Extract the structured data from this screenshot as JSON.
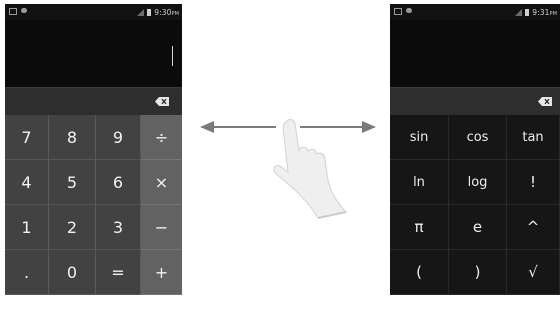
{
  "left_phone": {
    "status_time": "9:30",
    "status_ampm": "PM",
    "keys": [
      {
        "label": "7",
        "name": "key-7",
        "kind": "num"
      },
      {
        "label": "8",
        "name": "key-8",
        "kind": "num"
      },
      {
        "label": "9",
        "name": "key-9",
        "kind": "num"
      },
      {
        "label": "÷",
        "name": "key-divide",
        "kind": "op"
      },
      {
        "label": "4",
        "name": "key-4",
        "kind": "num"
      },
      {
        "label": "5",
        "name": "key-5",
        "kind": "num"
      },
      {
        "label": "6",
        "name": "key-6",
        "kind": "num"
      },
      {
        "label": "×",
        "name": "key-multiply",
        "kind": "op"
      },
      {
        "label": "1",
        "name": "key-1",
        "kind": "num"
      },
      {
        "label": "2",
        "name": "key-2",
        "kind": "num"
      },
      {
        "label": "3",
        "name": "key-3",
        "kind": "num"
      },
      {
        "label": "−",
        "name": "key-subtract",
        "kind": "op"
      },
      {
        "label": ".",
        "name": "key-decimal",
        "kind": "num"
      },
      {
        "label": "0",
        "name": "key-0",
        "kind": "num"
      },
      {
        "label": "=",
        "name": "key-equals",
        "kind": "num"
      },
      {
        "label": "+",
        "name": "key-add",
        "kind": "op"
      }
    ]
  },
  "right_phone": {
    "status_time": "9:31",
    "status_ampm": "PM",
    "keys": [
      {
        "label": "sin",
        "name": "key-sin",
        "kind": "sci"
      },
      {
        "label": "cos",
        "name": "key-cos",
        "kind": "sci"
      },
      {
        "label": "tan",
        "name": "key-tan",
        "kind": "sci"
      },
      {
        "label": "ln",
        "name": "key-ln",
        "kind": "sci"
      },
      {
        "label": "log",
        "name": "key-log",
        "kind": "sci"
      },
      {
        "label": "!",
        "name": "key-factorial",
        "kind": "sci"
      },
      {
        "label": "π",
        "name": "key-pi",
        "kind": "sci"
      },
      {
        "label": "e",
        "name": "key-e",
        "kind": "sci"
      },
      {
        "label": "^",
        "name": "key-power",
        "kind": "sci"
      },
      {
        "label": "(",
        "name": "key-open-paren",
        "kind": "sci"
      },
      {
        "label": ")",
        "name": "key-close-paren",
        "kind": "sci"
      },
      {
        "label": "√",
        "name": "key-sqrt",
        "kind": "sci"
      }
    ]
  },
  "icons": {
    "status_left": [
      "image-icon",
      "message-icon"
    ],
    "status_right": [
      "signal-icon",
      "battery-icon"
    ],
    "backspace": "backspace-icon",
    "gesture": "swipe-hand-icon",
    "arrows": [
      "arrow-left-icon",
      "arrow-right-icon"
    ]
  },
  "colors": {
    "number_key": "#424242",
    "operator_key": "#626262",
    "scientific_key": "#161616",
    "display": "#0b0b0b",
    "arrow": "#7a7a7a"
  }
}
